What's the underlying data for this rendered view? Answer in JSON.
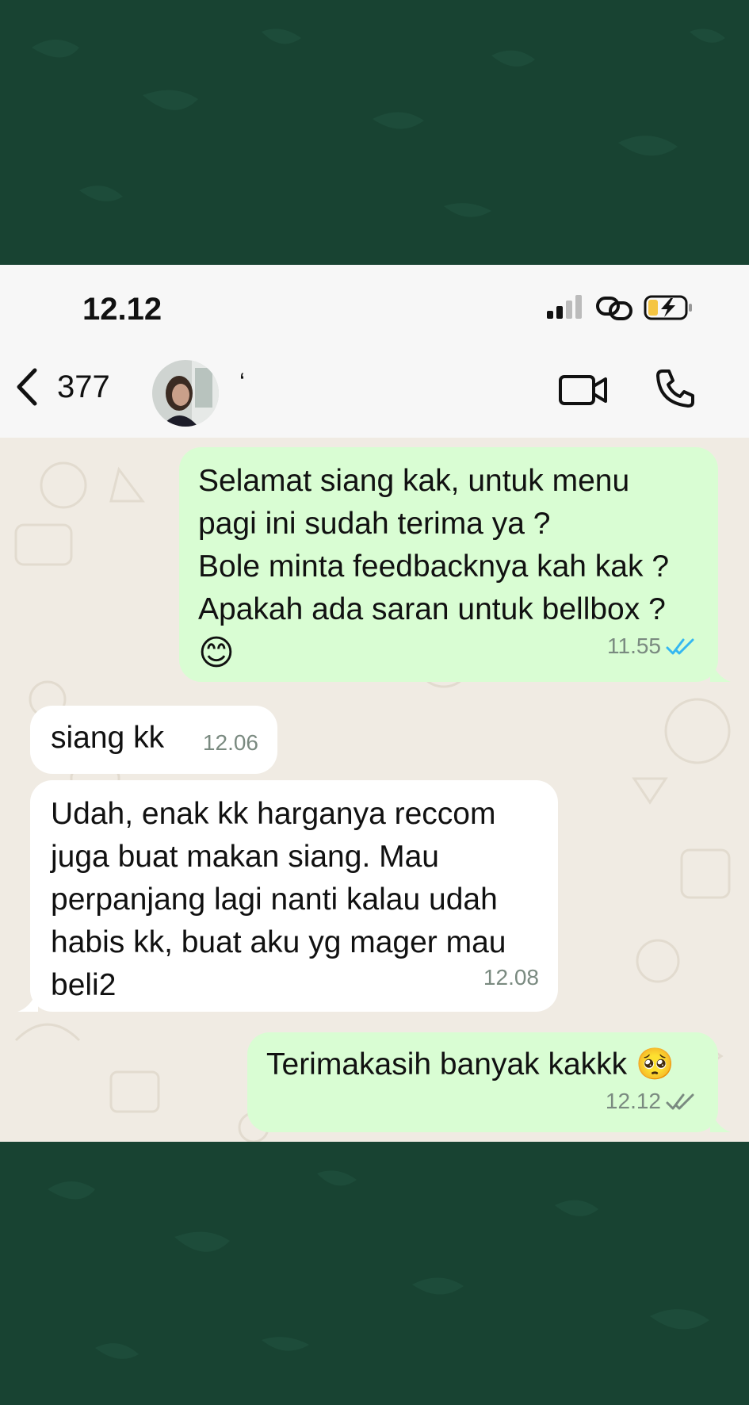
{
  "status_bar": {
    "time": "12.12",
    "icons": [
      "signal-icon",
      "link-icon",
      "battery-charging-icon"
    ]
  },
  "header": {
    "back_count": "377",
    "contact_name": "‘",
    "icons": [
      "back-chevron-icon",
      "video-call-icon",
      "phone-call-icon"
    ]
  },
  "messages": [
    {
      "direction": "outgoing",
      "text": "Selamat siang kak, untuk menu\npagi ini sudah terima ya ?\nBole minta feedbacknya kah kak ?\nApakah ada saran untuk bellbox ?",
      "emoji": "😊",
      "time": "11.55",
      "status": "read"
    },
    {
      "direction": "incoming",
      "text": "siang kk",
      "time": "12.06"
    },
    {
      "direction": "incoming",
      "text": "Udah, enak kk harganya reccom\njuga buat makan siang. Mau\nperpanjang lagi nanti kalau udah\nhabis kk, buat aku yg mager mau\nbeli2",
      "time": "12.08"
    },
    {
      "direction": "outgoing",
      "text": "Terimakasih banyak kakkk 🥺",
      "time": "12.12",
      "status": "delivered"
    }
  ],
  "colors": {
    "outer_background": "#184332",
    "outgoing_bubble": "#d9fdd3",
    "incoming_bubble": "#ffffff",
    "wallpaper": "#f0ebe3",
    "read_tick": "#34b7f1",
    "delivered_tick": "#7a8a80"
  }
}
